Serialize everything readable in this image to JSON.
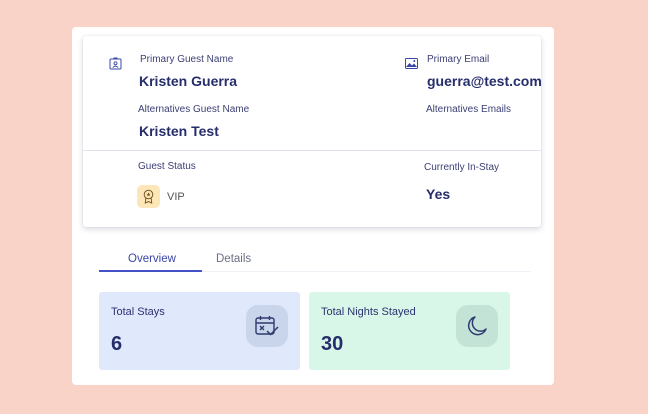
{
  "guest": {
    "primary_name_label": "Primary Guest Name",
    "primary_name": "Kristen Guerra",
    "alt_name_label": "Alternatives Guest Name",
    "alt_name": "Kristen Test",
    "primary_email_label": "Primary Email",
    "primary_email": "guerra@test.com",
    "alt_emails_label": "Alternatives Emails",
    "status_label": "Guest Status",
    "status_value": "VIP",
    "in_stay_label": "Currently In-Stay",
    "in_stay_value": "Yes"
  },
  "tabs": [
    {
      "label": "Overview",
      "active": true
    },
    {
      "label": "Details",
      "active": false
    }
  ],
  "stats": [
    {
      "label": "Total Stays",
      "value": "6",
      "bg": "#dfe9fb",
      "icon": "calendar-check-icon"
    },
    {
      "label": "Total Nights Stayed",
      "value": "30",
      "bg": "#d9f7e8",
      "icon": "moon-icon"
    }
  ],
  "colors": {
    "background": "#fad3c8",
    "accent": "#4452c8",
    "text_dark": "#262d6b",
    "vip_badge": "#fde6b8"
  }
}
